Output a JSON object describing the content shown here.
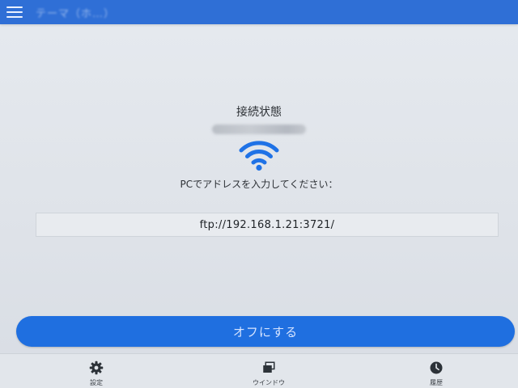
{
  "top_bar": {
    "title": "テーマ（ホ…）"
  },
  "status": {
    "title": "接続状態",
    "network_name": "",
    "instruction": "PCでアドレスを入力してください："
  },
  "address": {
    "url": "ftp://192.168.1.21:3721/"
  },
  "action": {
    "off_label": "オフにする"
  },
  "bottom_nav": {
    "settings_label": "設定",
    "window_label": "ウインドウ",
    "history_label": "履歴"
  },
  "colors": {
    "accent": "#1f6fe0",
    "top_bar": "#2f6fd6",
    "wifi": "#1f72e6"
  },
  "icons": {
    "menu": "hamburger-menu-icon",
    "status": "wifi-icon",
    "settings": "gear-icon",
    "window": "stacked-windows-icon",
    "history": "clock-icon"
  }
}
